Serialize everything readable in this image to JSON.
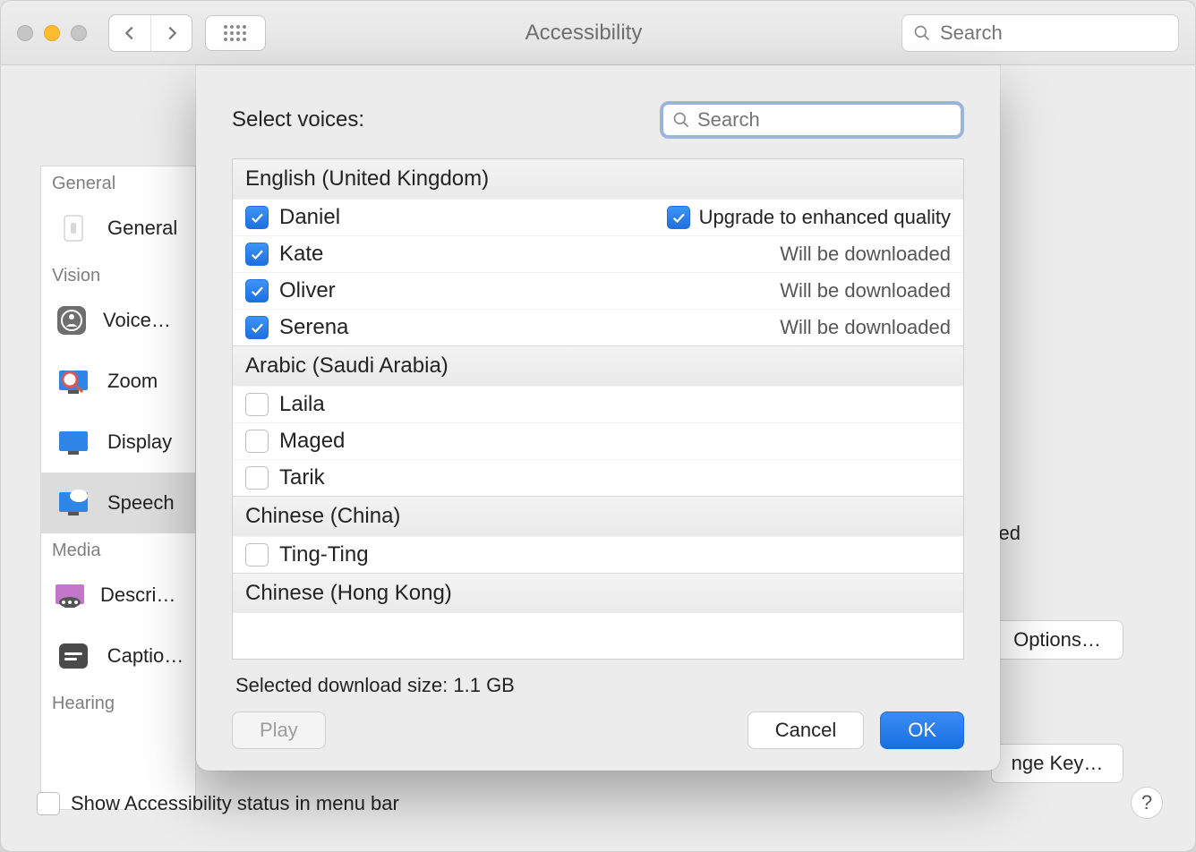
{
  "window": {
    "title": "Accessibility",
    "search_placeholder": "Search"
  },
  "sidebar": {
    "groups": [
      {
        "label": "General",
        "items": [
          {
            "label": "General"
          }
        ]
      },
      {
        "label": "Vision",
        "items": [
          {
            "label": "VoiceOver"
          },
          {
            "label": "Zoom"
          },
          {
            "label": "Display"
          },
          {
            "label": "Speech",
            "selected": true
          }
        ]
      },
      {
        "label": "Media",
        "items": [
          {
            "label": "Descriptions"
          },
          {
            "label": "Captions"
          }
        ]
      },
      {
        "label": "Hearing",
        "items": []
      }
    ]
  },
  "bg": {
    "need_text": "need",
    "options_btn": "Options…",
    "change_key_btn": "nge Key…"
  },
  "footer": {
    "show_status_label": "Show Accessibility status in menu bar",
    "help": "?"
  },
  "sheet": {
    "title": "Select voices:",
    "search_placeholder": "Search",
    "download_size_label": "Selected download size: 1.1 GB",
    "play_btn": "Play",
    "cancel_btn": "Cancel",
    "ok_btn": "OK",
    "upgrade_label": "Upgrade to enhanced quality",
    "will_download": "Will be downloaded",
    "sections": [
      {
        "label": "English (United Kingdom)",
        "voices": [
          {
            "name": "Daniel",
            "checked": true,
            "status": "upgrade"
          },
          {
            "name": "Kate",
            "checked": true,
            "status": "download"
          },
          {
            "name": "Oliver",
            "checked": true,
            "status": "download"
          },
          {
            "name": "Serena",
            "checked": true,
            "status": "download"
          }
        ]
      },
      {
        "label": "Arabic (Saudi Arabia)",
        "voices": [
          {
            "name": "Laila",
            "checked": false
          },
          {
            "name": "Maged",
            "checked": false
          },
          {
            "name": "Tarik",
            "checked": false
          }
        ]
      },
      {
        "label": "Chinese (China)",
        "voices": [
          {
            "name": "Ting-Ting",
            "checked": false
          }
        ]
      },
      {
        "label": "Chinese (Hong Kong)",
        "voices": []
      }
    ]
  }
}
